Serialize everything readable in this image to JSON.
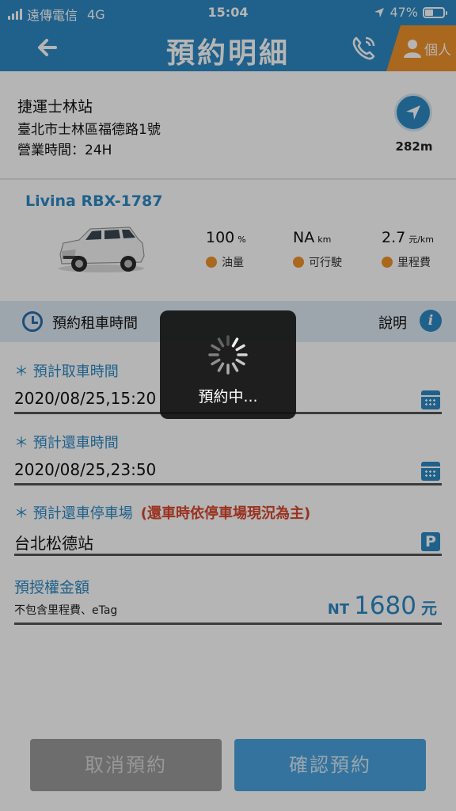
{
  "status_bar": {
    "carrier": "遠傳電信",
    "network": "4G",
    "time": "15:04",
    "battery": "47%",
    "battery_level": 0.47
  },
  "header": {
    "title": "預約明細",
    "personal_label": "個人"
  },
  "station": {
    "name": "捷運士林站",
    "address": "臺北市士林區福德路1號",
    "hours": "營業時間：24H",
    "distance": "282m"
  },
  "car": {
    "model": "Livina RBX-1787",
    "specs": [
      {
        "value": "100",
        "unit": "%",
        "label": "油量",
        "icon": "fuel-icon"
      },
      {
        "value": "NA",
        "unit": "km",
        "label": "可行駛",
        "icon": "range-icon"
      },
      {
        "value": "2.7",
        "unit": "元/km",
        "label": "里程費",
        "icon": "fee-icon"
      }
    ]
  },
  "reservation": {
    "section_title": "預約租車時間",
    "help_label": "說明"
  },
  "form": {
    "pickup": {
      "label": "＊ 預計取車時間",
      "value": "2020/08/25,15:20"
    },
    "return": {
      "label": "＊ 預計還車時間",
      "value": "2020/08/25,23:50"
    },
    "parking": {
      "label": "＊ 預計還車停車場",
      "note": "(還車時依停車場現況為主)",
      "value": "台北松德站",
      "icon_text": "P"
    }
  },
  "deposit": {
    "label": "預授權金額",
    "note": "不包含里程費、eTag",
    "currency": "NT",
    "amount": "1680",
    "unit": "元"
  },
  "buttons": {
    "cancel": "取消預約",
    "confirm": "確認預約"
  },
  "loading": {
    "message": "預約中..."
  },
  "colors": {
    "brand": "#2d89c4",
    "accent": "#f0922b",
    "warning": "#d9452c"
  }
}
